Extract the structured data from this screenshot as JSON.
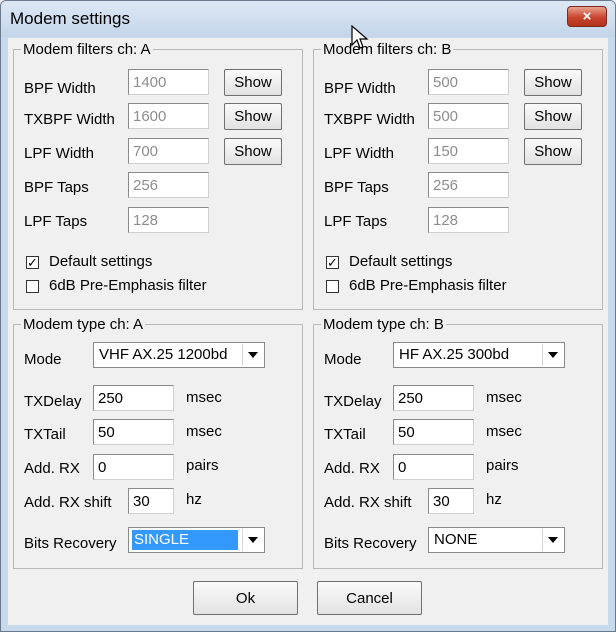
{
  "window": {
    "title": "Modem settings",
    "close_label": "×"
  },
  "filters_a": {
    "legend": "Modem filters ch: A",
    "rows": [
      {
        "label": "BPF Width",
        "value": "1400",
        "button": "Show"
      },
      {
        "label": "TXBPF Width",
        "value": "1600",
        "button": "Show"
      },
      {
        "label": "LPF Width",
        "value": "700",
        "button": "Show"
      },
      {
        "label": "BPF Taps",
        "value": "256"
      },
      {
        "label": "LPF Taps",
        "value": "128"
      }
    ],
    "default_settings": {
      "label": "Default settings",
      "checked": true
    },
    "preemphasis": {
      "label": "6dB Pre-Emphasis filter",
      "checked": false
    }
  },
  "filters_b": {
    "legend": "Modem filters ch: B",
    "rows": [
      {
        "label": "BPF Width",
        "value": "500",
        "button": "Show"
      },
      {
        "label": "TXBPF Width",
        "value": "500",
        "button": "Show"
      },
      {
        "label": "LPF Width",
        "value": "150",
        "button": "Show"
      },
      {
        "label": "BPF Taps",
        "value": "256"
      },
      {
        "label": "LPF Taps",
        "value": "128"
      }
    ],
    "default_settings": {
      "label": "Default settings",
      "checked": true
    },
    "preemphasis": {
      "label": "6dB Pre-Emphasis filter",
      "checked": false
    }
  },
  "type_a": {
    "legend": "Modem type ch: A",
    "mode": {
      "label": "Mode",
      "value": "VHF AX.25 1200bd"
    },
    "txdelay": {
      "label": "TXDelay",
      "value": "250",
      "unit": "msec"
    },
    "txtail": {
      "label": "TXTail",
      "value": "50",
      "unit": "msec"
    },
    "add_rx": {
      "label": "Add. RX",
      "value": "0",
      "unit": "pairs"
    },
    "add_rx_shift": {
      "label": "Add. RX shift",
      "value": "30",
      "unit": "hz"
    },
    "bits_recovery": {
      "label": "Bits Recovery",
      "value": "SINGLE"
    }
  },
  "type_b": {
    "legend": "Modem type ch: B",
    "mode": {
      "label": "Mode",
      "value": "HF AX.25 300bd"
    },
    "txdelay": {
      "label": "TXDelay",
      "value": "250",
      "unit": "msec"
    },
    "txtail": {
      "label": "TXTail",
      "value": "50",
      "unit": "msec"
    },
    "add_rx": {
      "label": "Add. RX",
      "value": "0",
      "unit": "pairs"
    },
    "add_rx_shift": {
      "label": "Add. RX shift",
      "value": "30",
      "unit": "hz"
    },
    "bits_recovery": {
      "label": "Bits Recovery",
      "value": "NONE"
    }
  },
  "buttons": {
    "ok": "Ok",
    "cancel": "Cancel"
  },
  "colors": {
    "selection": "#3399ff",
    "close_button": "#c8452e"
  }
}
